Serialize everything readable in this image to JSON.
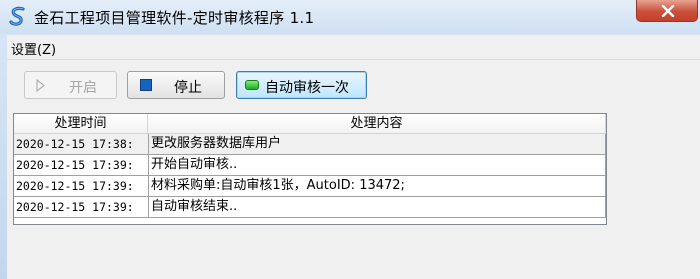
{
  "window": {
    "title": "金石工程项目管理软件-定时审核程序 1.1",
    "icon": "app-s-logo-icon",
    "close_icon": "close-icon"
  },
  "menu": {
    "items": [
      {
        "label": "设置(Z)"
      }
    ]
  },
  "toolbar": {
    "start_label": "开启",
    "start_icon": "play-icon",
    "start_enabled": false,
    "stop_label": "停止",
    "stop_icon": "stop-square-icon",
    "audit_once_label": "自动审核一次",
    "audit_once_icon": "green-led-icon"
  },
  "log_table": {
    "headers": [
      "处理时间",
      "处理内容"
    ],
    "rows": [
      {
        "time": "2020-12-15 17:38:",
        "message": "更改服务器数据库用户"
      },
      {
        "time": "2020-12-15 17:39:",
        "message": "开始自动审核.."
      },
      {
        "time": "2020-12-15 17:39:",
        "message": "材料采购单:自动审核1张，AutoID: 13472;"
      },
      {
        "time": "2020-12-15 17:39:",
        "message": "自动审核结束.."
      }
    ]
  },
  "colors": {
    "title_bg": "#cfe0f2",
    "close_button": "#c4412c",
    "stop_icon": "#1565c0",
    "audit_led": "#1fae1f",
    "button_focus_border": "#3c7fb1"
  }
}
